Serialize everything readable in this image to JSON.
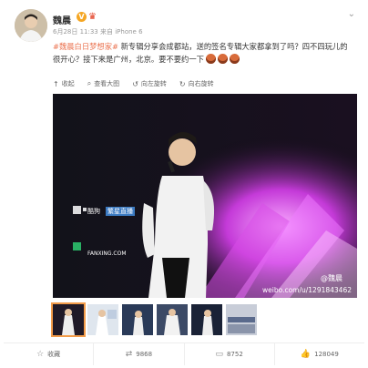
{
  "user": {
    "name": "魏晨",
    "vip_badge": "V"
  },
  "meta": {
    "time": "6月28日 11:33",
    "source": "来自 iPhone 6"
  },
  "post": {
    "hashtag": "#魏晨白日梦想家#",
    "text": " 新专辑分享会成都站，送的签名专辑大家都拿到了吗？四不四玩儿的很开心？接下来是广州，北京。要不要约一下"
  },
  "mediabar": {
    "collect": "收起",
    "view_large": "查看大图",
    "rotate_left": "向左旋转",
    "rotate_right": "向右旋转"
  },
  "photo": {
    "watermark_handle": "@魏晨",
    "watermark_url": "weibo.com/u/1291843462",
    "banner_brand_1": "酷狗",
    "banner_brand_2": "繁星直播",
    "banner_site": "FANXING.COM"
  },
  "footer": {
    "favorite": "收藏",
    "repost_count": "9868",
    "comment_count": "8752",
    "like_count": "128049"
  },
  "colors": {
    "hashtag": "#eb7350",
    "thumb_selected": "#f39c4a",
    "vip": "#f5a623"
  }
}
